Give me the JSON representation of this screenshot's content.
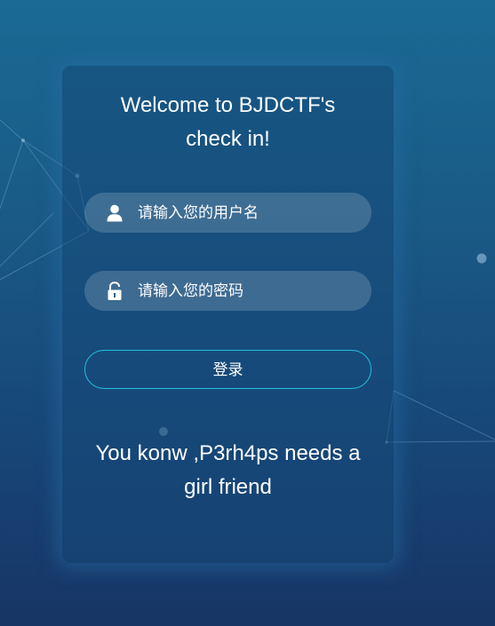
{
  "welcome": {
    "line1": "Welcome to BJDCTF's",
    "line2": "check in!"
  },
  "username": {
    "placeholder": "请输入您的用户名",
    "icon": "user-icon"
  },
  "password": {
    "placeholder": "请输入您的密码",
    "icon": "lock-icon"
  },
  "login_button": {
    "label": "登录"
  },
  "message": {
    "line1": "You konw ,P3rh4ps needs a",
    "line2": "girl friend"
  },
  "colors": {
    "button_border": "#1fc2e2",
    "background_top": "#1a6a95",
    "background_bottom": "#173565"
  }
}
